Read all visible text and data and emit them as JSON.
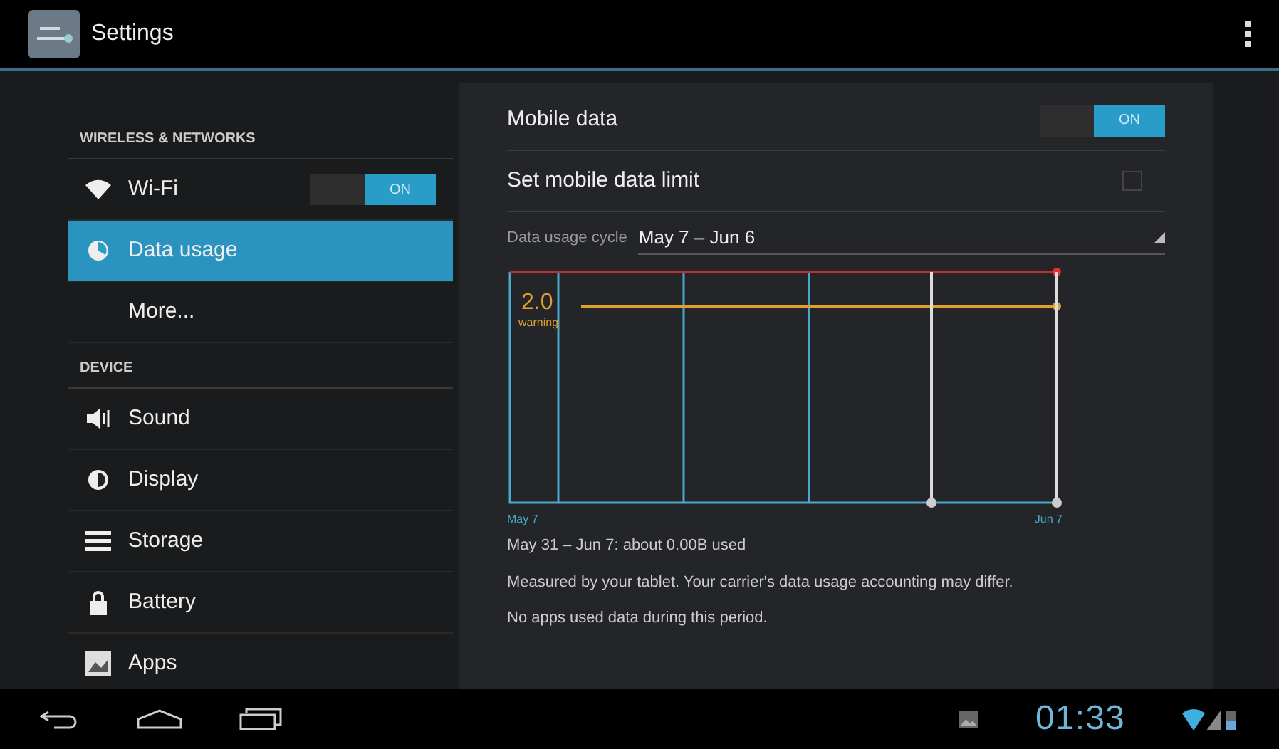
{
  "action_bar": {
    "title": "Settings"
  },
  "sidebar": {
    "items": [
      {
        "kind": "header",
        "label": "WIRELESS & NETWORKS"
      },
      {
        "kind": "toggle",
        "label": "Wi-Fi",
        "selected": false,
        "on": true,
        "toggle_label": "ON"
      },
      {
        "kind": "item",
        "label": "Data usage",
        "selected": true
      },
      {
        "kind": "item",
        "label": "More...",
        "selected": false
      },
      {
        "kind": "header",
        "label": "DEVICE"
      },
      {
        "kind": "item",
        "label": "Sound",
        "selected": false
      },
      {
        "kind": "item",
        "label": "Display",
        "selected": false
      },
      {
        "kind": "item",
        "label": "Storage",
        "selected": false
      },
      {
        "kind": "item",
        "label": "Battery",
        "selected": false
      },
      {
        "kind": "item",
        "label": "Apps",
        "selected": false
      }
    ]
  },
  "detail": {
    "mobile_data": {
      "label": "Mobile data",
      "on": true,
      "toggle_label": "ON"
    },
    "data_limit": {
      "label": "Set mobile data limit",
      "checked": false
    },
    "cycle": {
      "label": "Data usage cycle",
      "value": "May 7 – Jun 6"
    },
    "graph": {
      "warning_value": "2.0",
      "warning_label": "warning",
      "start_label": "May 7",
      "end_label": "Jun 7"
    },
    "usage_summary": "May 31 – Jun 7: about 0.00B used",
    "notes": [
      "Measured by your tablet. Your carrier's data usage accounting may differ.",
      "No apps used data during this period."
    ]
  },
  "status_bar": {
    "time": "01:33"
  }
}
